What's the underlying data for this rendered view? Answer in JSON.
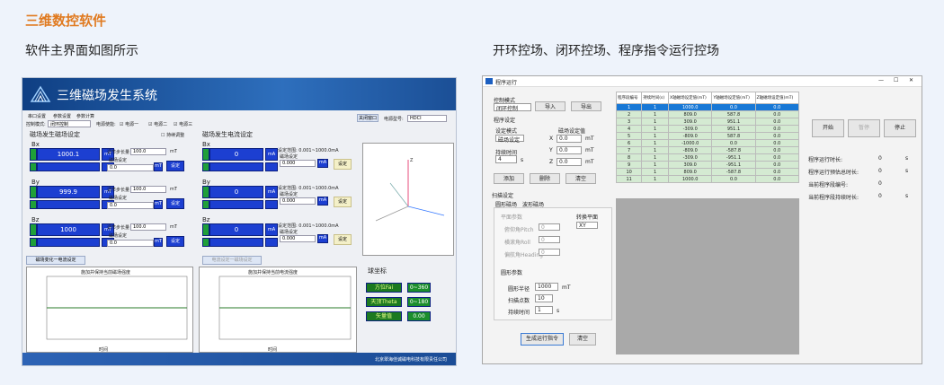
{
  "page_title": "三维数控软件",
  "left_caption": "软件主界面如图所示",
  "right_caption": "开环控场、闭环控场、程序指令运行控场",
  "left": {
    "app_title": "三维磁场发生系统",
    "menu": [
      "串口设置",
      "参数设置",
      "参数计算"
    ],
    "control_mode_label": "控制模式:",
    "control_mode": "闭环控制",
    "power_label": "电源使能:",
    "power": [
      "电源一",
      "电源二",
      "电源三"
    ],
    "close_all": "关闭窗口",
    "power_model_label": "电源型号:",
    "power_model": "HDCI",
    "field_title": "磁场发生磁场设定",
    "current_title": "磁场发生电流设定",
    "hold_adjust": "持续调整",
    "axes": [
      {
        "label": "Bx",
        "val": "1000.1",
        "unit": "mT",
        "step": "100.0",
        "sw": "0.0",
        "cur": "0",
        "cur_unit": "mA",
        "range": "设定范围: 0.001~1000.0mA",
        "cur_set": "0.000"
      },
      {
        "label": "By",
        "val": "999.9",
        "unit": "mT",
        "step": "100.0",
        "sw": "0.0",
        "cur": "0",
        "cur_unit": "mA",
        "range": "设定范围: 0.001~1000.0mA",
        "cur_set": "0.000"
      },
      {
        "label": "Bz",
        "val": "1000",
        "unit": "mT",
        "step": "100.0",
        "sw": "0.0",
        "cur": "0",
        "cur_unit": "mA",
        "range": "设定范围: 0.001~1000.0mA",
        "cur_set": "0.000"
      }
    ],
    "step_label": "调节步长量",
    "field_set_label": "磁场设定",
    "cur_set_label": "磁场设定",
    "set_btn": "设定",
    "chart_tab": "磁场变化一电流设定",
    "chart_tab2": "电流设定一磁场设定",
    "chart1_title": "施加并保持当前磁场强度",
    "chart2_title": "施加并保持当前电流强度",
    "xaxis": [
      "00:00",
      "00:10",
      "00:20",
      "00:30",
      "00:40",
      "00:50",
      "01:00",
      "01:10",
      "01:20"
    ],
    "yaxis": [
      "10",
      "8",
      "6",
      "4",
      "2",
      "0",
      "-2",
      "-4",
      "-6",
      "-8",
      "-10"
    ],
    "xlabel": "时间",
    "ylabel": "磁场强度",
    "sphere_title": "球坐标",
    "sphere": [
      {
        "label": "方位Fai",
        "range": "0~360"
      },
      {
        "label": "天顶Theta",
        "range": "0~180"
      },
      {
        "label": "矢量值",
        "range": "0.00"
      }
    ],
    "footer": "北京翠海佳诚磁电科技有限责任公司"
  },
  "right": {
    "win_title": "程序运行",
    "mode_label": "控制模式",
    "mode": "闭环控制",
    "import": "导入",
    "export": "导出",
    "prog_set": "程序设定",
    "set_mode": "设定模式",
    "set_mode_val": "磁场设定",
    "field_set": "磁场设定值",
    "dur": "持续时间",
    "dur_val": "4",
    "dur_unit": "s",
    "xyz": [
      {
        "a": "X",
        "v": "0.0"
      },
      {
        "a": "Y",
        "v": "0.0"
      },
      {
        "a": "Z",
        "v": "0.0"
      }
    ],
    "xyz_unit": "mT",
    "add": "添加",
    "del": "删除",
    "clear": "清空",
    "scan_set": "扫描设定",
    "tab_circle": "圆形磁场",
    "tab_rot": "波形磁场",
    "plane_param": "平面参数",
    "rot_plane": "转换平面",
    "plane_val": "XY",
    "pitch": "俯仰角Pitch",
    "roll": "横滚角Roll",
    "heading": "偏航角Heading",
    "zero": "0",
    "circle_param": "圆形参数",
    "radius": "圆形半径",
    "radius_val": "1000",
    "radius_unit": "mT",
    "points": "扫描点数",
    "points_val": "10",
    "hold": "持续时间",
    "hold_val": "1",
    "hold_unit": "s",
    "gen": "生成运行指令",
    "clear2": "清空",
    "headers": [
      "程序段编号",
      "持续时间(s)",
      "X轴磁场设定值(mT)",
      "Y轴磁场设定值(mT)",
      "Z轴磁场设定值(mT)"
    ],
    "rows": [
      [
        "1",
        "1",
        "1000.0",
        "0.0",
        "0.0"
      ],
      [
        "2",
        "1",
        "809.0",
        "587.8",
        "0.0"
      ],
      [
        "3",
        "1",
        "309.0",
        "951.1",
        "0.0"
      ],
      [
        "4",
        "1",
        "-309.0",
        "951.1",
        "0.0"
      ],
      [
        "5",
        "1",
        "-809.0",
        "587.8",
        "0.0"
      ],
      [
        "6",
        "1",
        "-1000.0",
        "0.0",
        "0.0"
      ],
      [
        "7",
        "1",
        "-809.0",
        "-587.8",
        "0.0"
      ],
      [
        "8",
        "1",
        "-309.0",
        "-951.1",
        "0.0"
      ],
      [
        "9",
        "1",
        "309.0",
        "-951.1",
        "0.0"
      ],
      [
        "10",
        "1",
        "809.0",
        "-587.8",
        "0.0"
      ],
      [
        "11",
        "1",
        "1000.0",
        "0.0",
        "0.0"
      ]
    ],
    "start": "开始",
    "pause": "暂停",
    "stop": "停止",
    "stats": [
      {
        "l": "程序运行时长:",
        "v": "0",
        "u": "s"
      },
      {
        "l": "程序运行预估总时长:",
        "v": "0",
        "u": "s"
      },
      {
        "l": "当前程序段编号:",
        "v": "0",
        "u": ""
      },
      {
        "l": "当前程序段持续时长:",
        "v": "0",
        "u": "s"
      }
    ]
  }
}
